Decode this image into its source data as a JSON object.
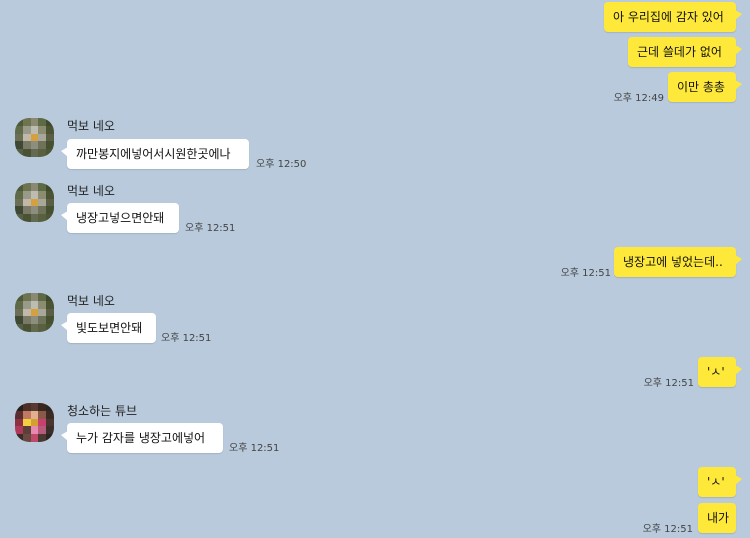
{
  "messages": {
    "m1": "아 우리집에 감자 있어",
    "m2": "근데 쓸데가 없어",
    "m3": "이만 총총",
    "m3_time": "오후 12:49",
    "n1_name": "먹보 네오",
    "n1_text": "까만봉지에넣어서시원한곳에나",
    "n1_time": "오후 12:50",
    "n2_name": "먹보 네오",
    "n2_text": "냉장고넣으면안돼",
    "n2_time": "오후 12:51",
    "m4": "냉장고에 넣었는데..",
    "m4_time": "오후 12:51",
    "n3_name": "먹보 네오",
    "n3_text": "빛도보면안돼",
    "n3_time": "오후 12:51",
    "m5": "'ㅅ'",
    "m5_time": "오후 12:51",
    "t1_name": "청소하는 튜브",
    "t1_text": "누가 감자를 냉장고에넣어",
    "t1_time": "오후 12:51",
    "m6": "'ㅅ'",
    "m7": "내가",
    "m7_time": "오후 12:51"
  },
  "colors": {
    "background": "#b8cadc",
    "my_bubble": "#fee93a",
    "other_bubble": "#ffffff"
  },
  "avatars": {
    "neo": [
      "#4e5a37",
      "#6e7350",
      "#8a8a72",
      "#5c6a46",
      "#3f4a2c",
      "#5e6a48",
      "#9a9a88",
      "#bcbcb0",
      "#8c8c70",
      "#4a5433",
      "#6a6f55",
      "#c0b8a8",
      "#d4a040",
      "#a8a89a",
      "#5a5e44",
      "#3e4832",
      "#7a7a66",
      "#8e8e7e",
      "#6e7258",
      "#44502f",
      "#556043",
      "#4a5236",
      "#636a50",
      "#58603f",
      "#4c5634"
    ],
    "tube": [
      "#2a1e1a",
      "#4a3028",
      "#5a3a30",
      "#3a2820",
      "#2e2420",
      "#5a2e30",
      "#c07a60",
      "#e0b090",
      "#8a5a48",
      "#3a2a24",
      "#8e3040",
      "#f0d040",
      "#d4a030",
      "#c84070",
      "#4a3430",
      "#b03858",
      "#5a4038",
      "#e88ab0",
      "#b85a7a",
      "#3a2e2a",
      "#3a2c28",
      "#6a4a40",
      "#c04a6a",
      "#4a3832",
      "#2c2420"
    ]
  }
}
